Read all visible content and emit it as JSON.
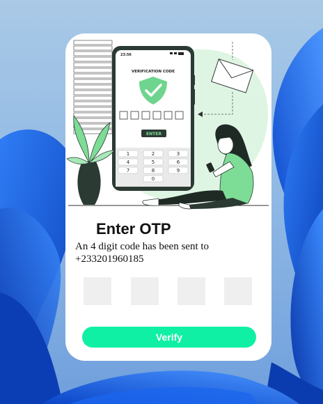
{
  "colors": {
    "accent": "#10f0a5",
    "illustration_green": "#7ddc96",
    "otp_box": "#efefef",
    "wallpaper_blue": "#1a5fe0"
  },
  "illustration": {
    "status_time": "23:56",
    "screen_title": "VERIFICATION CODE",
    "enter_label": "ENTER",
    "keypad": [
      "1",
      "2",
      "3",
      "4",
      "5",
      "6",
      "7",
      "8",
      "9",
      "0"
    ],
    "icons": [
      "shield-check-icon",
      "envelope-icon",
      "plant-icon"
    ]
  },
  "otp": {
    "title": "Enter OTP",
    "message": "An 4 digit code has been sent to +233201960185",
    "digits": [
      "",
      "",
      "",
      ""
    ]
  },
  "actions": {
    "verify_label": "Verify"
  }
}
